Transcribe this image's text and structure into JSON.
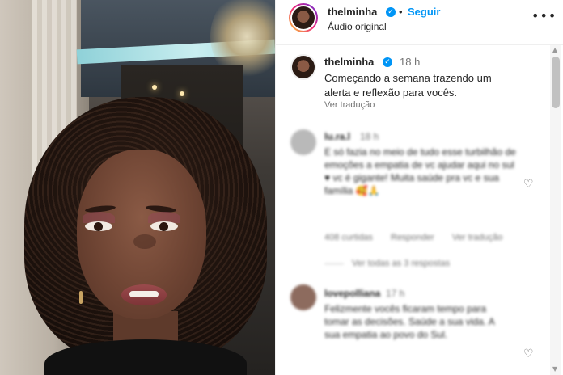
{
  "post": {
    "author": "thelminha",
    "verified_icon": "verified-badge-icon",
    "follow_label": "Seguir",
    "separator": "•",
    "audio_label": "Áudio original",
    "more_icon": "more-options-icon",
    "more_glyph": "•••"
  },
  "caption": {
    "author": "thelminha",
    "time": "18 h",
    "text": "Começando a semana trazendo um alerta e reflexão para vocês.",
    "translate_label": "Ver tradução"
  },
  "comments": [
    {
      "user": "lu.ra.l",
      "time": "18 h",
      "text": "E só fazia no meio de tudo esse turbilhão de emoções a empatia de vc ajudar aqui no sul ♥ vc é gigante! Muita saúde pra vc e sua família 🥰🙏",
      "likes": "408 curtidas",
      "reply_label": "Responder",
      "translate_label": "Ver tradução",
      "view_replies": "Ver todas as 3 respostas"
    },
    {
      "user": "lovepolliana",
      "time": "17 h",
      "text": "Felizmente vocês ficaram tempo para tomar as decisões. Saúde a sua vida. A sua empatia ao povo do Sul."
    }
  ],
  "colors": {
    "accent": "#0095f6",
    "text": "#262626",
    "muted": "#737373"
  }
}
